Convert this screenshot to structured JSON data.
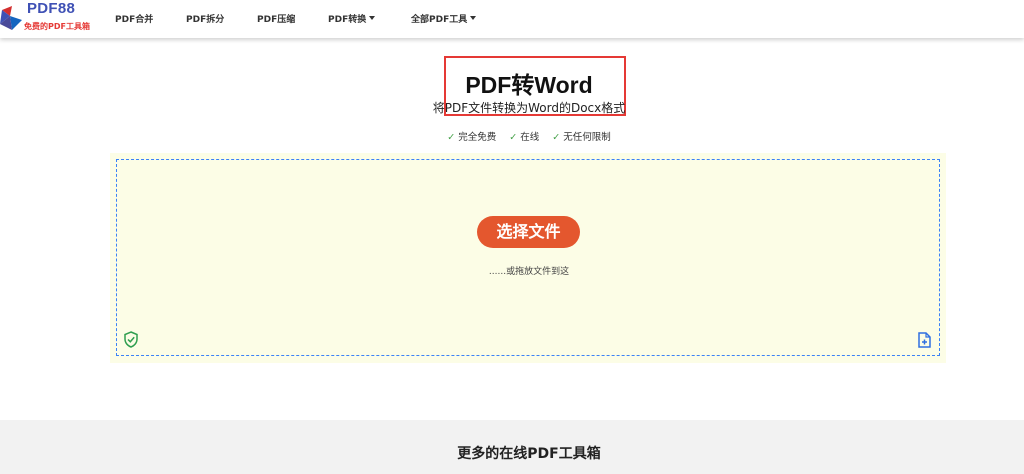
{
  "brand": {
    "name": "PDF88",
    "tagline": "免费的PDF工具箱"
  },
  "nav": [
    {
      "label": "PDF合并",
      "dropdown": false
    },
    {
      "label": "PDF拆分",
      "dropdown": false
    },
    {
      "label": "PDF压缩",
      "dropdown": false
    },
    {
      "label": "PDF转换",
      "dropdown": true
    },
    {
      "label": "全部PDF工具",
      "dropdown": true
    }
  ],
  "hero": {
    "title": "PDF转Word",
    "subtitle": "将PDF文件转换为Word的Docx格式",
    "features": [
      "完全免费",
      "在线",
      "无任何限制"
    ]
  },
  "upload": {
    "button_label": "选择文件",
    "hint": "......或拖放文件到这"
  },
  "footer": {
    "title": "更多的在线PDF工具箱"
  },
  "colors": {
    "brand_blue": "#3f51b5",
    "accent_orange": "#e4572e",
    "highlight_red": "#e53935",
    "dropzone_bg": "#fcfde6",
    "dashed_border": "#3b82f6",
    "check_green": "#43a047"
  },
  "icons": [
    "logo-mark",
    "shield-check-icon",
    "add-file-icon",
    "caret-down-icon",
    "check-icon"
  ]
}
